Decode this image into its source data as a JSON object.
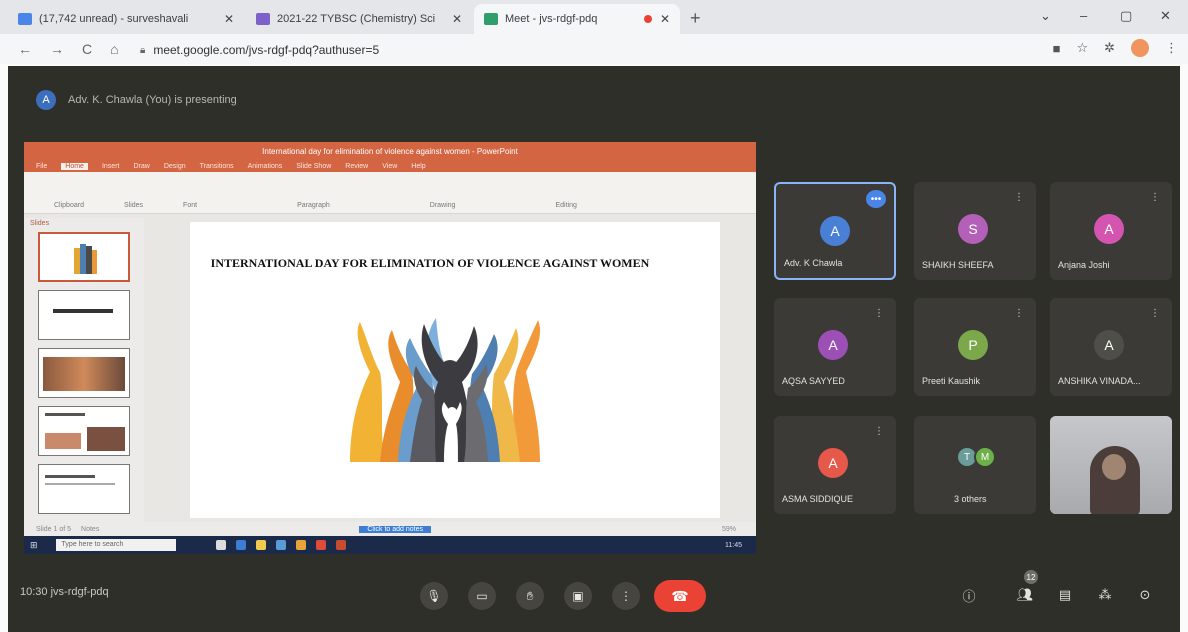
{
  "browser": {
    "tabs": [
      {
        "title": "(17,742 unread) - surveshavali",
        "close": "✕",
        "color": "#4a86e8"
      },
      {
        "title": "2021-22 TYBSC (Chemistry) Sci",
        "close": "✕",
        "color": "#7b61c9"
      },
      {
        "title": "Meet - jvs-rdgf-pdq",
        "close": "✕",
        "color": "#2f9e6b"
      }
    ],
    "new_tab": "+",
    "url": "meet.google.com/jvs-rdgf-pdq?authuser=5",
    "window_controls": {
      "minimize": "–",
      "maximize": "▢",
      "close": "✕"
    }
  },
  "meet": {
    "presenter_label": "Adv. K. Chawla (You) is presenting",
    "presenter_initial": "A",
    "meeting_code": "10:30   jvs-rdgf-pdq",
    "participants": [
      {
        "initial": "A",
        "name": "Adv. K Chawla",
        "color": "#4a7fd6"
      },
      {
        "initial": "S",
        "name": "SHAIKH SHEEFA",
        "color": "#b45fb8"
      },
      {
        "initial": "A",
        "name": "Anjana Joshi",
        "color": "#d455b0"
      },
      {
        "initial": "A",
        "name": "AQSA SAYYED",
        "color": "#9c50b6"
      },
      {
        "initial": "P",
        "name": "Preeti Kaushik",
        "color": "#7ba84a"
      },
      {
        "initial": "A",
        "name": "ANSHIKA VINADA...",
        "color": "#4f4f4a"
      },
      {
        "initial": "A",
        "name": "ASMA SIDDIQUE",
        "color": "#e6584a"
      }
    ],
    "others": {
      "label": "3 others",
      "initials": [
        "T",
        "M"
      ]
    },
    "more_badge": "•••",
    "participant_count": "12"
  },
  "presentation": {
    "app_title": "International day for elimination of violence against women - PowerPoint",
    "menu": [
      "File",
      "Home",
      "Insert",
      "Draw",
      "Design",
      "Transitions",
      "Animations",
      "Slide Show",
      "Review",
      "View",
      "Help"
    ],
    "ribbon_groups": [
      "Clipboard",
      "Slides",
      "Font",
      "Paragraph",
      "Drawing",
      "Editing"
    ],
    "thumbs_header": "Slides",
    "slide_title": "INTERNATIONAL DAY FOR ELIMINATION OF VIOLENCE AGAINST WOMEN",
    "status_left": "Slide 1 of 5",
    "notes_label": "Notes",
    "status_mid": "Click to add notes",
    "zoom": "59%",
    "taskbar_search": "Type here to search",
    "taskbar_time": "11:45"
  }
}
